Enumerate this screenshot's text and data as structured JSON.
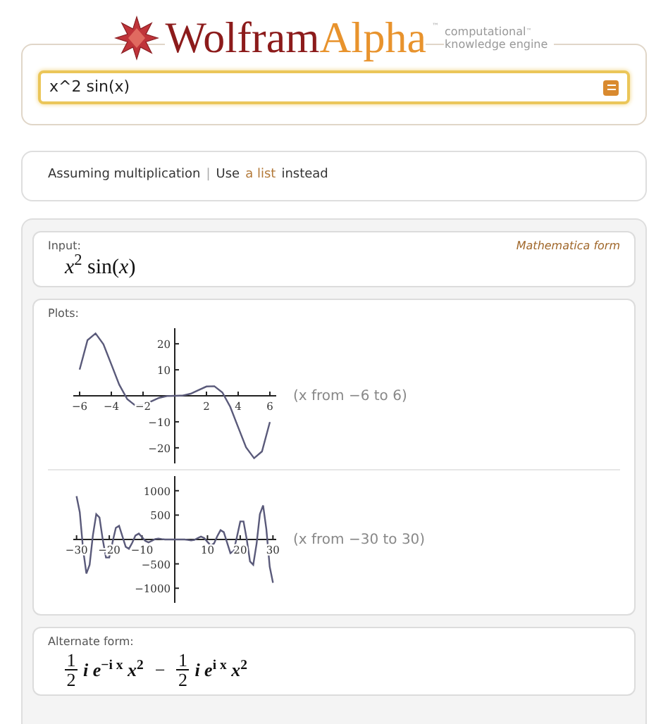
{
  "logo": {
    "brand_first": "Wolfram",
    "brand_second": "Alpha",
    "trademark": "™",
    "tagline_line_1": "computational",
    "tagline_mark": "™",
    "tagline_line_2": "knowledge engine"
  },
  "search": {
    "value": "x^2 sin(x)"
  },
  "assumption": {
    "text": "Assuming multiplication",
    "separator": "|",
    "prefix": "Use",
    "link": "a list",
    "suffix": "instead"
  },
  "pods": [
    {
      "kind": "math",
      "title": "Input:",
      "aside": "Mathematica form",
      "expression": "*x*$^{2}$ sin(*x*)"
    },
    {
      "kind": "plots",
      "title": "Plots:",
      "plots": [
        {
          "range_label": "(x from −6 to 6)",
          "chart_data": {
            "type": "line",
            "xlim": [
              -6.4,
              6.4
            ],
            "ylim": [
              -26,
              26
            ],
            "xticks": [
              {
                "value": -6,
                "label": "−6"
              },
              {
                "value": -4,
                "label": "−4"
              },
              {
                "value": -2,
                "label": "−2"
              },
              {
                "value": 2,
                "label": "2"
              },
              {
                "value": 4,
                "label": "4"
              },
              {
                "value": 6,
                "label": "6"
              }
            ],
            "yticks": [
              {
                "value": -20,
                "label": "−20"
              },
              {
                "value": -10,
                "label": "−10"
              },
              {
                "value": 10,
                "label": "10"
              },
              {
                "value": 20,
                "label": "20"
              }
            ],
            "x": [
              -6,
              -5.5,
              -5,
              -4.5,
              -4,
              -3.5,
              -3,
              -2.5,
              -2,
              -1.5,
              -1,
              -0.5,
              0,
              0.5,
              1,
              1.5,
              2,
              2.5,
              3,
              3.5,
              4,
              4.5,
              5,
              5.5,
              6
            ],
            "series": [
              {
                "color": "#5a5a7a",
                "values": [
                  10.1,
                  21.4,
                  24,
                  19.8,
                  12.1,
                  4.3,
                  -1.3,
                  -3.7,
                  -3.6,
                  -2.2,
                  -0.8,
                  -0.1,
                  0,
                  0.1,
                  0.8,
                  2.2,
                  3.6,
                  3.7,
                  1.3,
                  -4.3,
                  -12.1,
                  -19.8,
                  -24,
                  -21.4,
                  -10.1
                ]
              }
            ]
          }
        },
        {
          "range_label": "(x from −30 to 30)",
          "chart_data": {
            "type": "line",
            "xlim": [
              -31,
              31
            ],
            "ylim": [
              -1300,
              1300
            ],
            "xticks": [
              {
                "value": -30,
                "label": "−30"
              },
              {
                "value": -20,
                "label": "−20"
              },
              {
                "value": -10,
                "label": "−10"
              },
              {
                "value": 10,
                "label": "10"
              },
              {
                "value": 20,
                "label": "20"
              },
              {
                "value": 30,
                "label": "30"
              }
            ],
            "yticks": [
              {
                "value": -1000,
                "label": "−1000"
              },
              {
                "value": -500,
                "label": "−500"
              },
              {
                "value": 500,
                "label": "500"
              },
              {
                "value": 1000,
                "label": "1000"
              }
            ],
            "x": [
              -30,
              -29,
              -28,
              -27,
              -26,
              -25,
              -24,
              -23,
              -22,
              -21,
              -20,
              -19,
              -18,
              -17,
              -16,
              -15,
              -14,
              -13,
              -12,
              -11,
              -10,
              -9,
              -8,
              -7,
              -6,
              -5,
              -4,
              -3,
              -2,
              -1,
              0,
              1,
              2,
              3,
              4,
              5,
              6,
              7,
              8,
              9,
              10,
              11,
              12,
              13,
              14,
              15,
              16,
              17,
              18,
              19,
              20,
              21,
              22,
              23,
              24,
              25,
              26,
              27,
              28,
              29,
              30
            ],
            "series": [
              {
                "color": "#5a5a7a",
                "values": [
                  890,
                  560,
                  -210,
                  -700,
                  -520,
                  80,
                  520,
                  450,
                  0,
                  -370,
                  -370,
                  -50,
                  240,
                  280,
                  70,
                  -150,
                  -190,
                  -70,
                  80,
                  120,
                  50,
                  -30,
                  -60,
                  -30,
                  10,
                  20,
                  10,
                  0,
                  0,
                  0,
                  0,
                  0,
                  0,
                  0,
                  -10,
                  -20,
                  -10,
                  30,
                  60,
                  30,
                  -50,
                  -120,
                  -80,
                  70,
                  190,
                  150,
                  -70,
                  -280,
                  -240,
                  50,
                  370,
                  370,
                  0,
                  -450,
                  -520,
                  -80,
                  520,
                  700,
                  210,
                  -560,
                  -890
                ]
              }
            ]
          }
        }
      ]
    },
    {
      "kind": "fraction_math",
      "title": "Alternate form:",
      "terms": [
        {
          "numerator": "1",
          "denominator": "2",
          "body": "*i e*$^{−i x}$ *x*$^{2}$",
          "operator": "−"
        },
        {
          "numerator": "1",
          "denominator": "2",
          "body": "*i e*$^{i x}$ *x*$^{2}$"
        }
      ]
    }
  ]
}
